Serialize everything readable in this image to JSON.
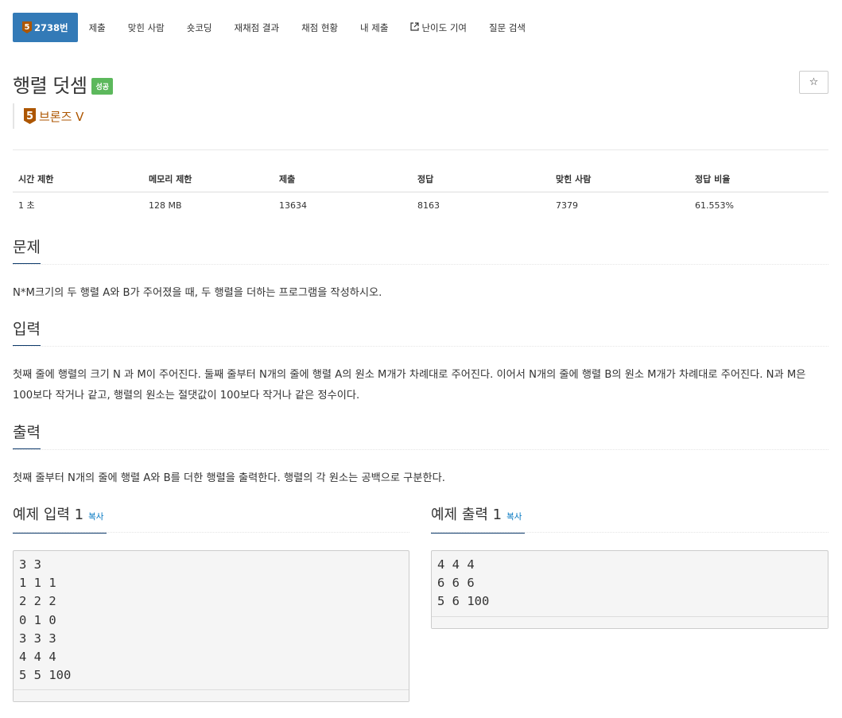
{
  "tabs": {
    "problem_tab": {
      "tier": "5",
      "label": "2738번"
    },
    "items": [
      "제출",
      "맞힌 사람",
      "숏코딩",
      "재채점 결과",
      "채점 현황",
      "내 제출",
      "난이도 기여",
      "질문 검색"
    ]
  },
  "problem": {
    "title": "행렬 덧셈",
    "status": "성공",
    "star": "☆",
    "tier_number": "5",
    "tier": "브론즈 V"
  },
  "info_table": {
    "headers": [
      "시간 제한",
      "메모리 제한",
      "제출",
      "정답",
      "맞힌 사람",
      "정답 비율"
    ],
    "values": [
      "1 초",
      "128 MB",
      "13634",
      "8163",
      "7379",
      "61.553%"
    ]
  },
  "sections": {
    "problem_heading": "문제",
    "problem_text": "N*M크기의 두 행렬 A와 B가 주어졌을 때, 두 행렬을 더하는 프로그램을 작성하시오.",
    "input_heading": "입력",
    "input_text": "첫째 줄에 행렬의 크기 N 과 M이 주어진다. 둘째 줄부터 N개의 줄에 행렬 A의 원소 M개가 차례대로 주어진다. 이어서 N개의 줄에 행렬 B의 원소 M개가 차례대로 주어진다. N과 M은 100보다 작거나 같고, 행렬의 원소는 절댓값이 100보다 작거나 같은 정수이다.",
    "output_heading": "출력",
    "output_text": "첫째 줄부터 N개의 줄에 행렬 A와 B를 더한 행렬을 출력한다. 행렬의 각 원소는 공백으로 구분한다."
  },
  "samples": {
    "input_heading": "예제 입력 1",
    "output_heading": "예제 출력 1",
    "copy_label": "복사",
    "input_text": "3 3\n1 1 1\n2 2 2\n0 1 0\n3 3 3\n4 4 4\n5 5 100",
    "output_text": "4 4 4\n6 6 6\n5 6 100"
  },
  "colors": {
    "active_tab": "#337ab7",
    "success_label": "#5cb85c",
    "bronze": "#ad5600",
    "link": "#0076c0"
  }
}
